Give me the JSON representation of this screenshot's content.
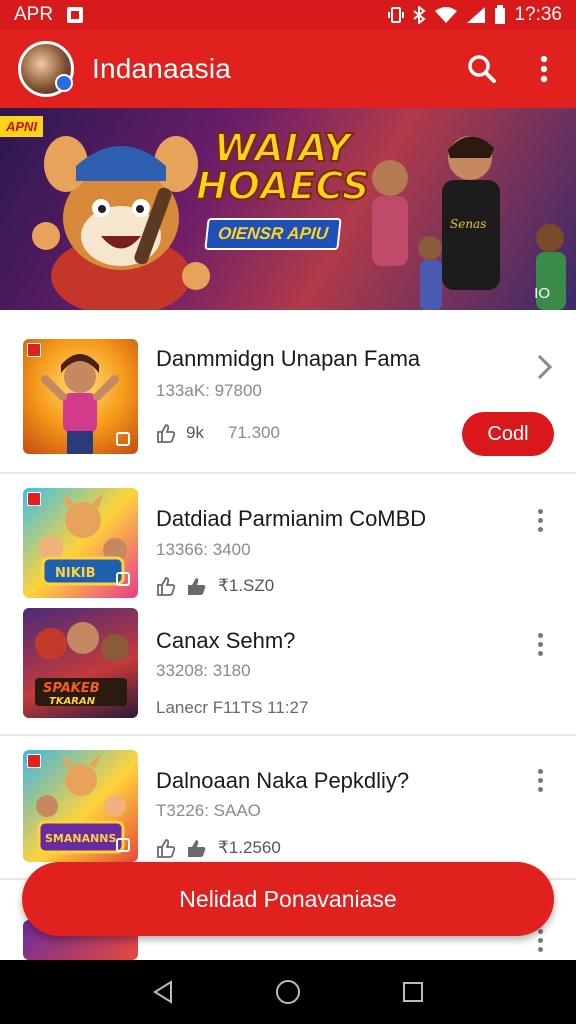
{
  "status_bar": {
    "carrier": "APR",
    "time": "1?:36"
  },
  "app_bar": {
    "title": "Indanaasia"
  },
  "banner": {
    "tag": "APNI",
    "line1": "WAIAY",
    "line2": "HOAECS",
    "pill_prefix": "OIENSR",
    "pill_suffix": "APIU",
    "corner": "IO"
  },
  "items": [
    {
      "title": "Danmmidgn Unapan Fama",
      "sub": "133aK: 97800",
      "meta": "9k",
      "meta2": "71.300",
      "action": "Codl"
    },
    {
      "title": "Datdiad Parmianim CoMBD",
      "sub": "13366: 3400",
      "meta": "₹1.SZ0"
    },
    {
      "title": "Canax Sehm?",
      "sub": "33208: 3180",
      "meta": "Lanecr F11TS  11:27"
    },
    {
      "title": "Dalnoaan Naka Pepkdliy?",
      "sub": "T3226: SAAO",
      "meta": "₹1.2560"
    }
  ],
  "fab": {
    "label": "Nelidad Ponavaniase"
  },
  "colors": {
    "primary": "#e0211d",
    "status": "#d91a1a",
    "text": "#1a1a1a",
    "muted": "#8a8a8a"
  }
}
